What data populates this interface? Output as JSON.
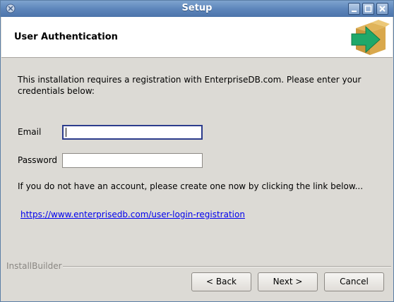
{
  "window": {
    "title": "Setup"
  },
  "header": {
    "title": "User Authentication"
  },
  "content": {
    "description": "This installation requires a registration with EnterpriseDB.com. Please enter your credentials below:",
    "email_label": "Email",
    "email_value": "",
    "password_label": "Password",
    "password_value": "",
    "hint": "If you do not have an account, please create one now by clicking the link below...",
    "link": "https://www.enterprisedb.com/user-login-registration"
  },
  "footer": {
    "brand": "InstallBuilder",
    "back_label": "< Back",
    "next_label": "Next >",
    "cancel_label": "Cancel"
  },
  "colors": {
    "titlebar": "#5e86bb",
    "link": "#0000ee",
    "focus_border": "#2b3b8c"
  },
  "icons": [
    "app-icon",
    "minimize-icon",
    "maximize-icon",
    "close-icon",
    "installer-box-arrow-icon"
  ]
}
